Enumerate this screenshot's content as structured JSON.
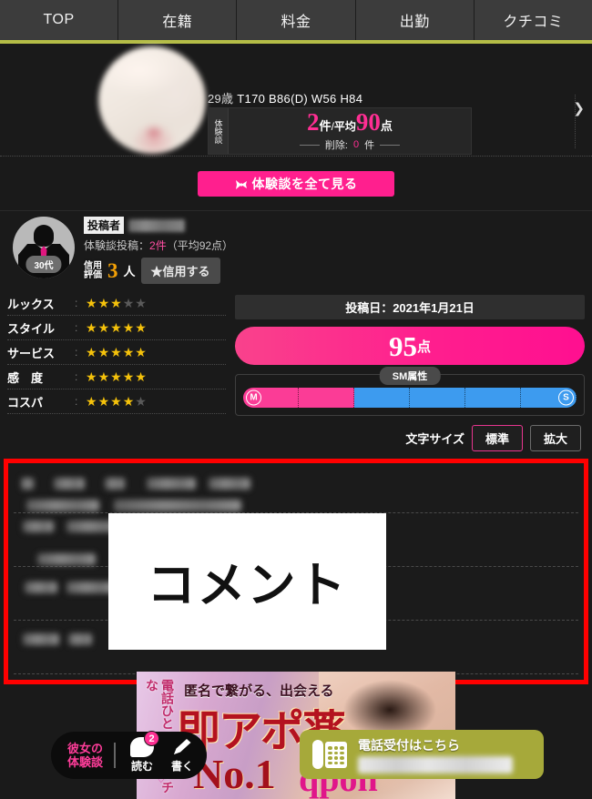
{
  "nav": {
    "items": [
      {
        "label": "TOP"
      },
      {
        "label": "在籍"
      },
      {
        "label": "料金"
      },
      {
        "label": "出勤"
      },
      {
        "label": "クチコミ"
      }
    ]
  },
  "profile": {
    "spec": "29歳 T170 B86(D) W56 H84",
    "spec_age": "29歳",
    "spec_rest": "T170 B86(D) W56 H84",
    "stat_label": "体験談",
    "stat_count": "2",
    "stat_count_unit": "件",
    "stat_separator": "/",
    "stat_avg_label": "平均",
    "stat_avg_value": "90",
    "stat_avg_unit": "点",
    "stat_deleted_label": "削除:",
    "stat_deleted_count": "0",
    "stat_deleted_unit": "件",
    "next_icon": "chevron-right-icon"
  },
  "view_all_button": {
    "label": "体験談を全て見る",
    "icon": "ribbon-icon"
  },
  "reviewer": {
    "age_badge": "30代",
    "poster_tag": "投稿者",
    "poster_name_redacted": "",
    "post_stats_prefix": "体験談投稿：",
    "post_count": "2件",
    "post_avg": "（平均92点）",
    "trust_label_line1": "信用",
    "trust_label_line2": "評価",
    "trust_count": "3",
    "trust_unit": "人",
    "trust_button": "★信用する"
  },
  "ratings": {
    "max_stars": 5,
    "rows": [
      {
        "name": "ルックス",
        "value": 3
      },
      {
        "name": "スタイル",
        "value": 5
      },
      {
        "name": "サービス",
        "value": 5
      },
      {
        "name": "感　度",
        "value": 5
      },
      {
        "name": "コスパ",
        "value": 4
      }
    ],
    "colon": ":"
  },
  "score": {
    "date_label": "投稿日：2021年1月21日",
    "value": "95",
    "unit": "点"
  },
  "sm": {
    "title": "SM属性",
    "left_cap": "M",
    "right_cap": "S",
    "segments": 6,
    "m_segments": 2,
    "s_segments": 4,
    "m_color": "#fb3c96",
    "s_color": "#3d9bef"
  },
  "text_size": {
    "label": "文字サイズ",
    "options": [
      {
        "label": "標準",
        "active": true
      },
      {
        "label": "拡大",
        "active": false
      }
    ]
  },
  "comment": {
    "overlay_text": "コメント",
    "border_color": "#ff0000",
    "rows_blurred": 5
  },
  "banner": {
    "vertical_text": "電話ひとつでエッチな",
    "top_text": "匿名で繋がる、出会える",
    "main_text": "即アポ薬",
    "no1_text": "No.1",
    "brand_text": "qpon",
    "heart": "♡"
  },
  "floating": {
    "title_line1": "彼女の",
    "title_line2": "体験談",
    "actions": [
      {
        "label": "読む",
        "icon": "speech-bubble-icon",
        "badge": "2"
      },
      {
        "label": "書く",
        "icon": "pencil-icon",
        "badge": ""
      }
    ]
  },
  "phone_cta": {
    "icon": "telephone-icon",
    "heading": "電話受付はこちら",
    "number_redacted": ""
  }
}
